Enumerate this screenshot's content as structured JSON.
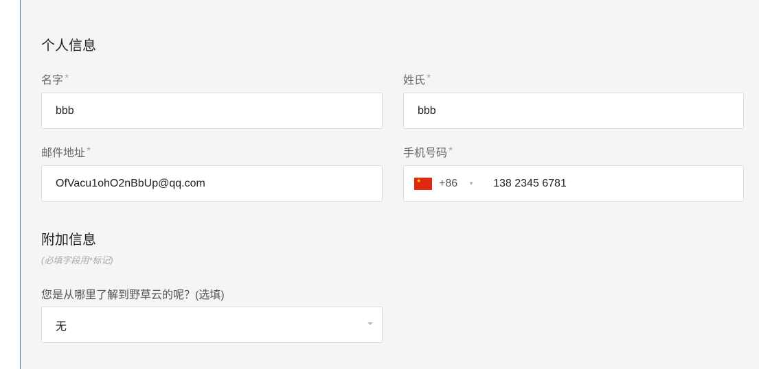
{
  "personal": {
    "title": "个人信息",
    "first_name_label": "名字",
    "first_name_value": "bbb",
    "last_name_label": "姓氏",
    "last_name_value": "bbb",
    "email_label": "邮件地址",
    "email_value": "OfVacu1ohO2nBbUp@qq.com",
    "phone_label": "手机号码",
    "phone_country_code": "+86",
    "phone_country_flag": "china-flag-icon",
    "phone_value": "138 2345 6781",
    "required_mark": "*"
  },
  "additional": {
    "title": "附加信息",
    "hint": "(必填字段用*标记)",
    "source_label": "您是从哪里了解到野草云的呢？(选填)",
    "source_value": "无"
  },
  "colors": {
    "accent_border": "#3b82c4",
    "panel_bg": "#f5f5f5"
  }
}
